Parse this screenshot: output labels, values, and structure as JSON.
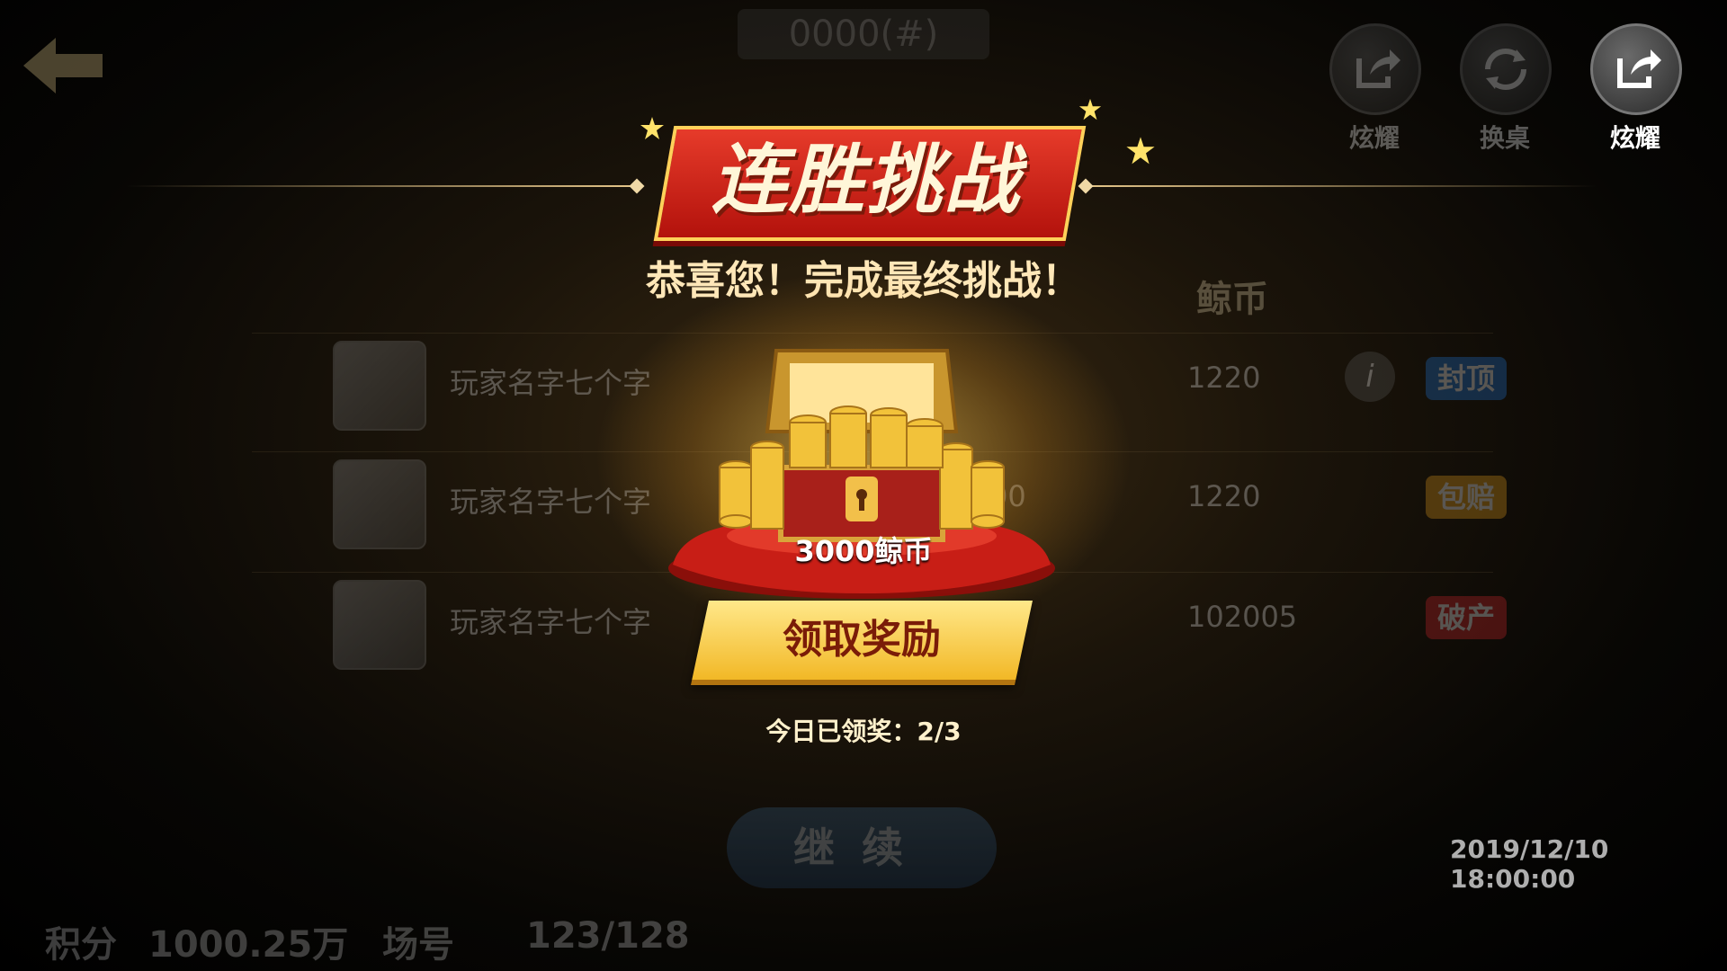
{
  "background": {
    "title": "0000(#)",
    "columns": [
      "鲸币"
    ],
    "rows": [
      {
        "name": "玩家名字七个字",
        "points": "1220",
        "tag": "封顶",
        "tag_color": "#1f6fc9",
        "extra": "i"
      },
      {
        "name": "玩家名字七个字",
        "points": "1220",
        "tag": "包赔",
        "tag_color": "#d9961c",
        "extra": "00"
      },
      {
        "name": "玩家名字七个字",
        "points": "102005",
        "tag": "破产",
        "tag_color": "#c9252a",
        "extra": ""
      }
    ],
    "continue_label": "继续",
    "timestamp": "2019/12/10  18:00:00",
    "bottom": {
      "score_label": "积分",
      "score_value": "1000.25万",
      "ticket_label": "场号",
      "ticket_value": "123/128"
    }
  },
  "top_right": {
    "buttons": [
      {
        "label": "炫耀",
        "icon": "share-icon",
        "dim": true
      },
      {
        "label": "换桌",
        "icon": "refresh-icon",
        "dim": true
      },
      {
        "label": "炫耀",
        "icon": "share-icon",
        "dim": false
      }
    ]
  },
  "popup": {
    "banner_title": "连胜挑战",
    "congrats": "恭喜您！完成最终挑战！",
    "reward_amount": "3000鲸币",
    "claim_button": "领取奖励",
    "claimed_label": "今日已领奖：",
    "claimed_count": "2/3"
  },
  "colors": {
    "banner_red": "#d42a1c",
    "claim_gold": "#f7c533",
    "accent_text": "#ffe7b8"
  }
}
